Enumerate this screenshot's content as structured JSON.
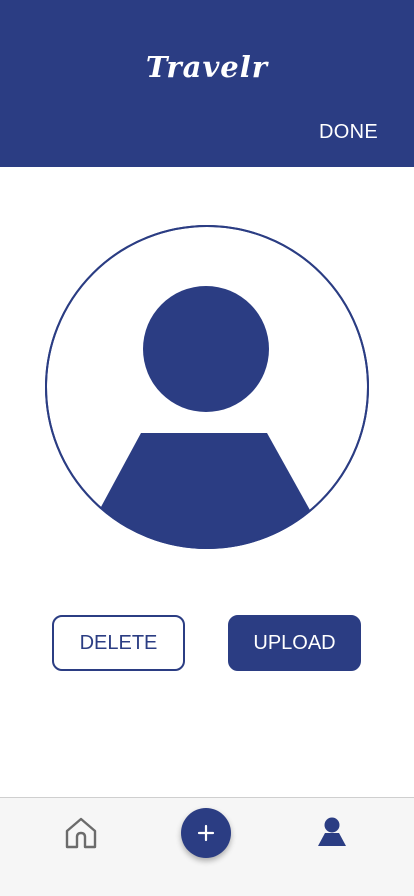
{
  "header": {
    "title": "Travelr",
    "done_label": "DONE"
  },
  "profile_photo": {
    "icon": "default-avatar-icon"
  },
  "actions": {
    "delete_label": "DELETE",
    "upload_label": "UPLOAD"
  },
  "bottom_nav": {
    "items": [
      {
        "icon": "home-icon",
        "active": false
      },
      {
        "icon": "plus-icon",
        "active": false
      },
      {
        "icon": "profile-icon",
        "active": true
      }
    ]
  },
  "colors": {
    "brand": "#2b3d83",
    "nav_background": "#f6f6f6",
    "inactive_icon": "#6b6b6b"
  }
}
